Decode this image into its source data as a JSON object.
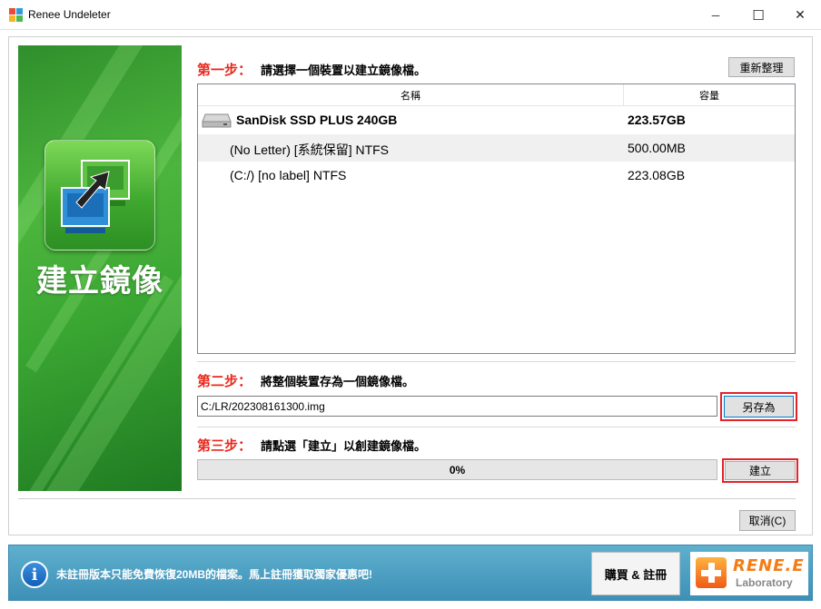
{
  "window": {
    "title": "Renee Undeleter",
    "minimize_glyph": "─",
    "maximize_glyph": "☐",
    "close_glyph": "✕"
  },
  "banner": {
    "label": "建立鏡像"
  },
  "step1": {
    "number": "第一步：",
    "text": "請選擇一個裝置以建立鏡像檔。",
    "refresh_label": "重新整理"
  },
  "device_table": {
    "headers": {
      "name": "名稱",
      "size": "容量"
    },
    "rows": [
      {
        "name": "SanDisk SSD PLUS 240GB",
        "size": "223.57GB",
        "kind": "disk"
      },
      {
        "name": "(No Letter) [系統保留] NTFS",
        "size": "500.00MB",
        "kind": "partition"
      },
      {
        "name": "(C:/) [no label] NTFS",
        "size": "223.08GB",
        "kind": "partition"
      }
    ]
  },
  "step2": {
    "number": "第二步：",
    "text": "將整個裝置存為一個鏡像檔。",
    "path_value": "C:/LR/202308161300.img",
    "save_as_label": "另存為"
  },
  "step3": {
    "number": "第三步：",
    "text": "請點選「建立」以創建鏡像檔。",
    "progress_text": "0%",
    "progress_fraction": 0,
    "create_label": "建立"
  },
  "cancel_label": "取消(C)",
  "footer": {
    "message": "未註冊版本只能免費恢復20MB的檔案。馬上註冊獲取獨家優惠吧!",
    "buy_label": "購買 & 註冊",
    "logo_brand": "RENE.E",
    "logo_sub": "Laboratory"
  },
  "colors": {
    "step_red": "#e8281d",
    "highlight_red": "#e3222a",
    "banner_green": "#3aa632",
    "footer_blue": "#3d90b7",
    "progress_green": "#06b025"
  }
}
